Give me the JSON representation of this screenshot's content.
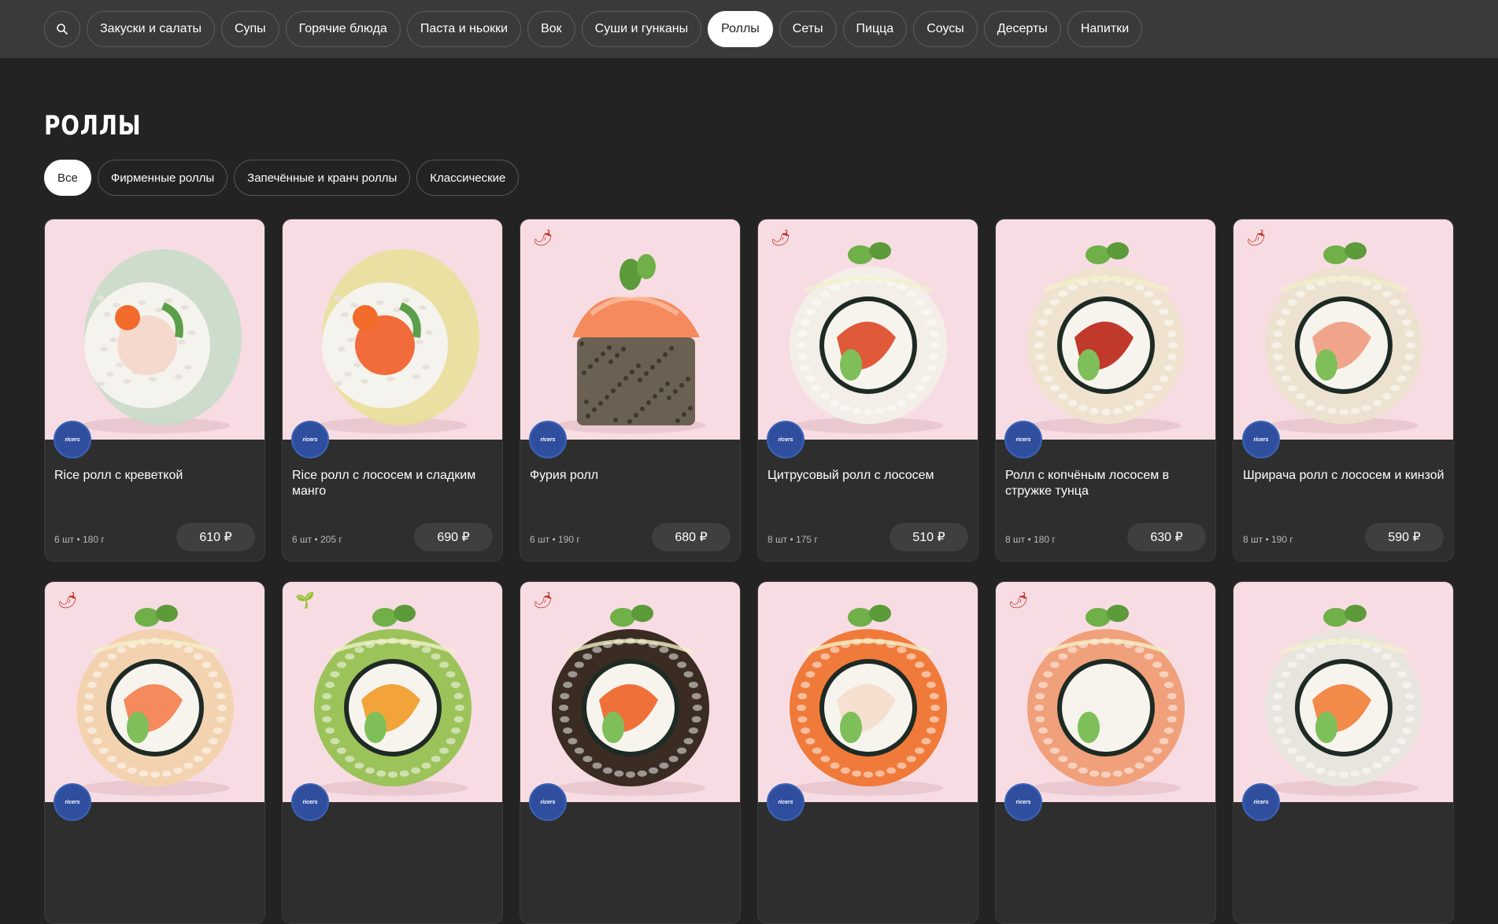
{
  "nav": {
    "search_icon": "search-icon",
    "items": [
      {
        "label": "Закуски и салаты",
        "active": false
      },
      {
        "label": "Супы",
        "active": false
      },
      {
        "label": "Горячие блюда",
        "active": false
      },
      {
        "label": "Паста и ньокки",
        "active": false
      },
      {
        "label": "Вок",
        "active": false
      },
      {
        "label": "Суши и гунканы",
        "active": false
      },
      {
        "label": "Роллы",
        "active": true
      },
      {
        "label": "Сеты",
        "active": false
      },
      {
        "label": "Пицца",
        "active": false
      },
      {
        "label": "Соусы",
        "active": false
      },
      {
        "label": "Десерты",
        "active": false
      },
      {
        "label": "Напитки",
        "active": false
      }
    ]
  },
  "page": {
    "title": "РОЛЛЫ"
  },
  "filters": [
    {
      "label": "Все",
      "active": true
    },
    {
      "label": "Фирменные роллы",
      "active": false
    },
    {
      "label": "Запечённые и кранч роллы",
      "active": false
    },
    {
      "label": "Классические",
      "active": false
    }
  ],
  "brand_badge_text": "ricers",
  "products": [
    {
      "name": "Rice ролл с креветкой",
      "meta": "6 шт • 180 г",
      "price": "610 ₽",
      "tag": "",
      "style": "paper",
      "wrap": "#c9dcc9",
      "accent": "#f5d9cc"
    },
    {
      "name": "Rice ролл с лососем и сладким манго",
      "meta": "6 шт • 205 г",
      "price": "690 ₽",
      "tag": "",
      "style": "paper",
      "wrap": "#e8e09a",
      "accent": "#f26b3a"
    },
    {
      "name": "Фурия ролл",
      "meta": "6 шт • 190 г",
      "price": "680 ₽",
      "tag": "chili",
      "style": "block",
      "wrap": "#6b6152",
      "accent": "#f58a5c"
    },
    {
      "name": "Цитрусовый ролл с лососем",
      "meta": "8 шт • 175 г",
      "price": "510 ₽",
      "tag": "chili",
      "style": "uramaki",
      "wrap": "#f3efe8",
      "accent": "#e05a3a"
    },
    {
      "name": "Ролл с копчёным лососем в стружке тунца",
      "meta": "8 шт • 180 г",
      "price": "630 ₽",
      "tag": "",
      "style": "uramaki",
      "wrap": "#efe3d0",
      "accent": "#c0392b"
    },
    {
      "name": "Шрирача ролл с лососем и кинзой",
      "meta": "8 шт • 190 г",
      "price": "590 ₽",
      "tag": "chili",
      "style": "uramaki",
      "wrap": "#ece2cf",
      "accent": "#f0a48a"
    },
    {
      "name": "",
      "meta": "",
      "price": "",
      "tag": "chili",
      "style": "uramaki",
      "wrap": "#f3d2b0",
      "accent": "#f58a5c"
    },
    {
      "name": "",
      "meta": "",
      "price": "",
      "tag": "leaf",
      "style": "uramaki",
      "wrap": "#9cc25a",
      "accent": "#f2a43a"
    },
    {
      "name": "",
      "meta": "",
      "price": "",
      "tag": "chili",
      "style": "uramaki",
      "wrap": "#3a2c22",
      "accent": "#f0703a"
    },
    {
      "name": "",
      "meta": "",
      "price": "",
      "tag": "",
      "style": "uramaki",
      "wrap": "#f07a3a",
      "accent": "#f5e0d0"
    },
    {
      "name": "",
      "meta": "",
      "price": "",
      "tag": "chili",
      "style": "uramaki",
      "wrap": "#f0a07a",
      "accent": "#f7f3ec"
    },
    {
      "name": "",
      "meta": "",
      "price": "",
      "tag": "",
      "style": "uramaki",
      "wrap": "#e8e4de",
      "accent": "#f28a4a"
    }
  ]
}
